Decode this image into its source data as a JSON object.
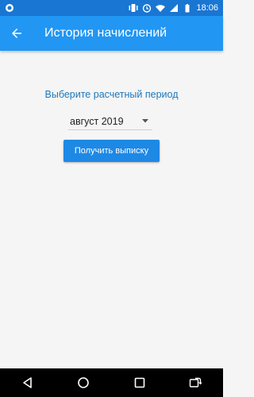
{
  "status_bar": {
    "time": "18:06",
    "icons": [
      "app-notification-icon",
      "vibrate-icon",
      "alarm-icon",
      "wifi-icon",
      "signal-icon",
      "battery-icon"
    ]
  },
  "app_bar": {
    "title": "История начислений",
    "back_icon": "arrow-back-icon"
  },
  "main": {
    "period_label": "Выберите расчетный период",
    "period_select": {
      "selected": "август 2019"
    },
    "get_button_label": "Получить выписку"
  },
  "nav_bar": {
    "icons": [
      "back-triangle-icon",
      "home-circle-icon",
      "recents-square-icon",
      "screen-rotate-icon"
    ]
  },
  "colors": {
    "status_bar": "#1976d2",
    "app_bar": "#2196f3",
    "accent": "#1e88e5",
    "label_text": "#1e78b9",
    "background": "#f5f5f5"
  }
}
